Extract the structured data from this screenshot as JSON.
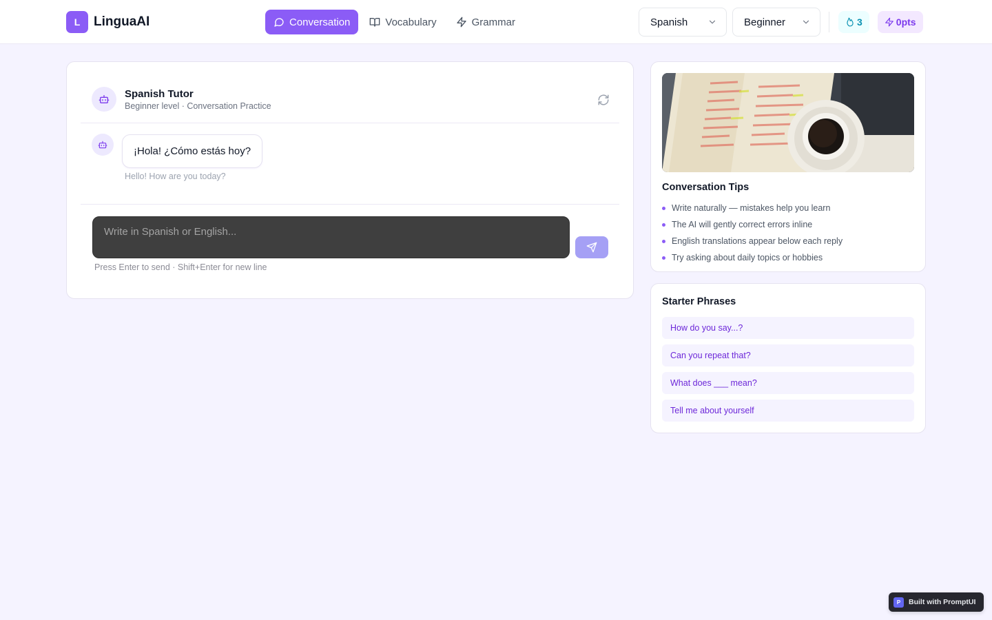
{
  "app": {
    "logo_letter": "L",
    "name": "LinguaAI"
  },
  "nav": {
    "tabs": [
      {
        "label": "Conversation",
        "icon": "chat-bubble-icon",
        "active": true
      },
      {
        "label": "Vocabulary",
        "icon": "book-icon",
        "active": false
      },
      {
        "label": "Grammar",
        "icon": "lightning-icon",
        "active": false
      }
    ]
  },
  "controls": {
    "language": "Spanish",
    "level": "Beginner",
    "streak": "3",
    "points": "0pts"
  },
  "chat": {
    "tutor_name": "Spanish Tutor",
    "tutor_subtitle": "Beginner level · Conversation Practice",
    "messages": [
      {
        "role": "tutor",
        "text": "¡Hola! ¿Cómo estás hoy?",
        "translation": "Hello! How are you today?"
      }
    ],
    "input_placeholder": "Write in Spanish or English...",
    "hint": "Press Enter to send · Shift+Enter for new line"
  },
  "tips": {
    "title": "Conversation Tips",
    "items": [
      "Write naturally — mistakes help you learn",
      "The AI will gently correct errors inline",
      "English translations appear below each reply",
      "Try asking about daily topics or hobbies"
    ]
  },
  "phrases": {
    "title": "Starter Phrases",
    "items": [
      "How do you say...?",
      "Can you repeat that?",
      "What does ___ mean?",
      "Tell me about yourself"
    ]
  },
  "footer": {
    "badge_letter": "P",
    "built_with": "Built with PromptUI"
  },
  "colors": {
    "accent": "#8b5cf6",
    "page_bg": "#f5f3ff",
    "streak": "#0891b2",
    "composer_bg": "#3f3f3f"
  }
}
